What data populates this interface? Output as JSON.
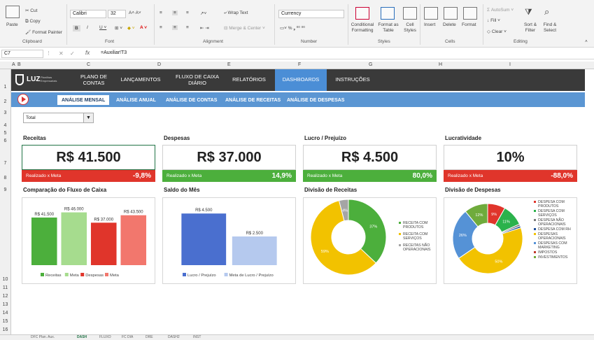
{
  "ribbon": {
    "paste": "Paste",
    "cut": "Cut",
    "copy": "Copy",
    "format_painter": "Format Painter",
    "clipboard": "Clipboard",
    "font_name": "Calibri",
    "font_size": "32",
    "font": "Font",
    "wrap_text": "Wrap Text",
    "merge_center": "Merge & Center",
    "alignment": "Alignment",
    "number_format": "Currency",
    "number": "Number",
    "conditional_formatting": "Conditional Formatting",
    "format_as_table": "Format as Table",
    "cell_styles": "Cell Styles",
    "styles": "Styles",
    "insert": "Insert",
    "delete": "Delete",
    "format": "Format",
    "cells": "Cells",
    "autosum": "AutoSum",
    "fill": "Fill",
    "clear": "Clear",
    "sort_filter": "Sort & Filter",
    "find_select": "Find & Select",
    "editing": "Editing"
  },
  "formula_bar": {
    "name_box": "C7",
    "formula": "=Auxiliar!T3"
  },
  "columns": [
    "A",
    "B",
    "C",
    "D",
    "E",
    "F",
    "G",
    "H",
    "I"
  ],
  "rows": [
    "1",
    "2",
    "3",
    "4",
    "5",
    "6",
    "7",
    "8",
    "9",
    "10",
    "11",
    "12",
    "13",
    "14",
    "15",
    "16"
  ],
  "nav": {
    "logo": "LUZ",
    "logo_sub": "Planilhas Empresariais",
    "items": [
      "PLANO DE CONTAS",
      "LANÇAMENTOS",
      "FLUXO DE CAIXA DIÁRIO",
      "RELATÓRIOS",
      "DASHBOARDS",
      "INSTRUÇÕES"
    ]
  },
  "subnav": [
    "ANÁLISE MENSAL",
    "ANÁLISE ANUAL",
    "ANÁLISE DE CONTAS",
    "ANÁLISE DE RECEITAS",
    "ANÁLISE DE DESPESAS"
  ],
  "filter": {
    "value": "Total"
  },
  "kpis": [
    {
      "title": "Receitas",
      "value": "R$ 41.500",
      "bar_label": "Realizado x Meta",
      "bar_value": "-9,8%",
      "bar_color": "#e0352b"
    },
    {
      "title": "Despesas",
      "value": "R$ 37.000",
      "bar_label": "Realizado x Meta",
      "bar_value": "14,9%",
      "bar_color": "#4caf3c"
    },
    {
      "title": "Lucro / Prejuízo",
      "value": "R$ 4.500",
      "bar_label": "Realizado x Meta",
      "bar_value": "80,0%",
      "bar_color": "#4caf3c"
    },
    {
      "title": "Lucratividade",
      "value": "10%",
      "bar_label": "Realizado x Meta",
      "bar_value": "-88,0%",
      "bar_color": "#e0352b"
    }
  ],
  "chart_titles": [
    "Comparação do Fluxo de Caixa",
    "Saldo do Mês",
    "Divisão de Receitas",
    "Divisão de Despesas"
  ],
  "chart_data": [
    {
      "type": "bar",
      "title": "Comparação do Fluxo de Caixa",
      "categories": [
        "Receitas",
        "Meta",
        "Despesas",
        "Meta"
      ],
      "values": [
        41500,
        46000,
        37000,
        43500
      ],
      "labels": [
        "R$ 41.500",
        "R$ 46.000",
        "R$ 37.000",
        "R$ 43.500"
      ],
      "colors": [
        "#4caf3c",
        "#a6dc8e",
        "#e0352b",
        "#f2776d"
      ],
      "ylim": [
        0,
        50000
      ]
    },
    {
      "type": "bar",
      "title": "Saldo do Mês",
      "categories": [
        "Lucro / Prejuízo",
        "Meta de Lucro / Prejuízo"
      ],
      "values": [
        4500,
        2500
      ],
      "labels": [
        "R$ 4.500",
        "R$ 2.500"
      ],
      "colors": [
        "#4a6fcf",
        "#b5c9ee"
      ],
      "ylim": [
        0,
        5000
      ]
    },
    {
      "type": "pie",
      "title": "Divisão de Receitas",
      "categories": [
        "RECEITA COM PRODUTOS",
        "RECEITA COM SERVIÇOS",
        "RECEITAS NÃO OPERACIONAIS"
      ],
      "values": [
        37,
        59,
        4
      ],
      "labels": [
        "37%",
        "59%",
        "4%"
      ],
      "colors": [
        "#4caf3c",
        "#f2c200",
        "#a5a5a5"
      ]
    },
    {
      "type": "pie",
      "title": "Divisão de Despesas",
      "categories": [
        "DESPESA COM PRODUTOS",
        "DESPESA COM SERVIÇOS",
        "DESPESA NÃO OPERACIONAIS",
        "DESPESA COM RH",
        "DESPESAS OPERACIONAIS",
        "DESPESAS COM MARKETING",
        "IMPOSTOS",
        "INVESTIMENTOS"
      ],
      "values": [
        9,
        11,
        1,
        1,
        50,
        26,
        0,
        12
      ],
      "labels": [
        "9%",
        "11%",
        "",
        "",
        "50%",
        "26%",
        "",
        "12%"
      ],
      "colors": [
        "#e0352b",
        "#2bb24c",
        "#7a7a7a",
        "#1f4e99",
        "#f2c200",
        "#5592d6",
        "#c0392b",
        "#6fab3c"
      ]
    }
  ],
  "sheet_tabs": [
    "DFC Plan. Aux.",
    "DASH",
    "FLUXO",
    "FC DIA",
    "DRE",
    "DASH2",
    "INST"
  ]
}
